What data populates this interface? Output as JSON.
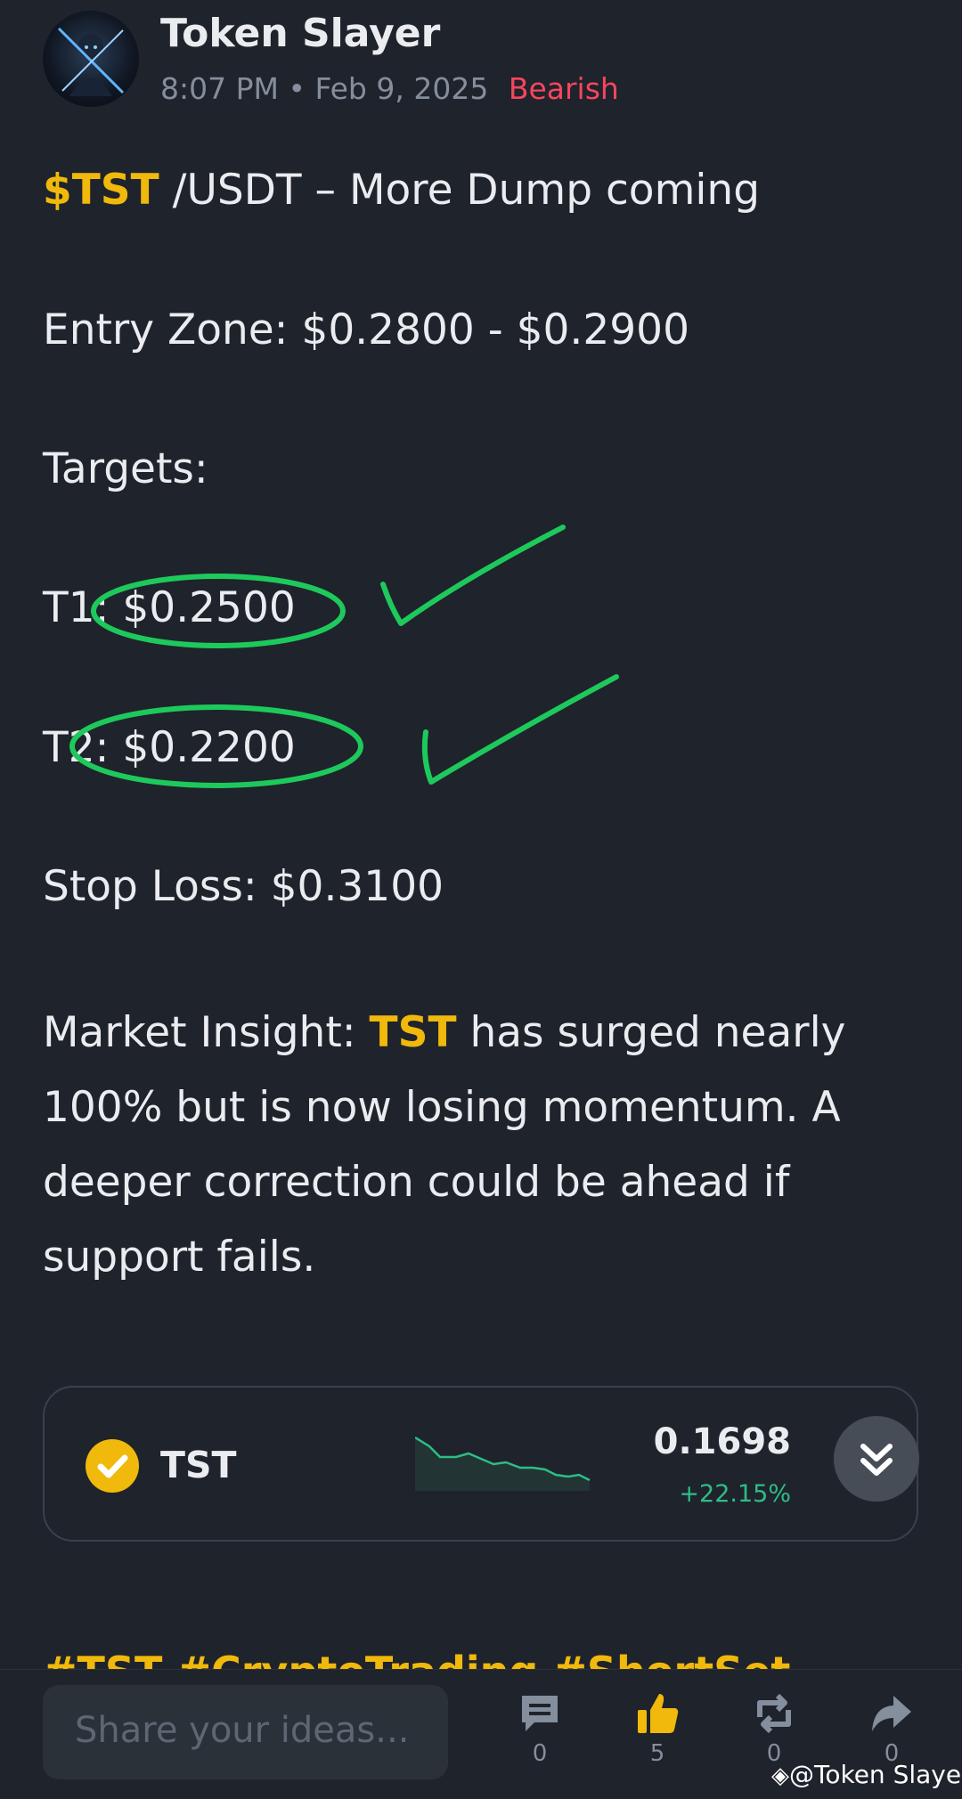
{
  "post": {
    "author": "Token Slayer",
    "time": "8:07 PM",
    "date": "Feb 9, 2025",
    "sentiment": "Bearish",
    "title_cashtag": "$TST",
    "title_rest": " /USDT – More Dump coming",
    "entry_zone": "Entry Zone: $0.2800 - $0.2900",
    "targets_label": "Targets:",
    "t1": "T1: $0.2500",
    "t2": "T2: $0.2200",
    "stop_loss": "Stop Loss: $0.3100",
    "insight_prefix": "Market Insight: ",
    "insight_ticker": "TST",
    "insight_rest": " has surged nearly 100% but is now losing momentum. A deeper correction could be ahead if support fails.",
    "hashtags": "#TST #CryptoTrading #ShortSet"
  },
  "ticker_card": {
    "symbol": "TST",
    "price": "0.1698",
    "change": "+22.15%"
  },
  "bottom_bar": {
    "placeholder": "Share your ideas...",
    "comments": "0",
    "likes": "5",
    "reposts": "0",
    "shares": "0"
  },
  "watermark": "@Token Slayer",
  "colors": {
    "background": "#1f232c",
    "accent": "#f0b90b",
    "bearish": "#f6465d",
    "positive": "#2ebd85",
    "annotation": "#1ec95c"
  },
  "icons": [
    "avatar",
    "check-circle-icon",
    "chevrons-down-icon",
    "comment-icon",
    "thumbs-up-icon",
    "repost-icon",
    "share-arrow-icon",
    "binance-logo-icon"
  ]
}
